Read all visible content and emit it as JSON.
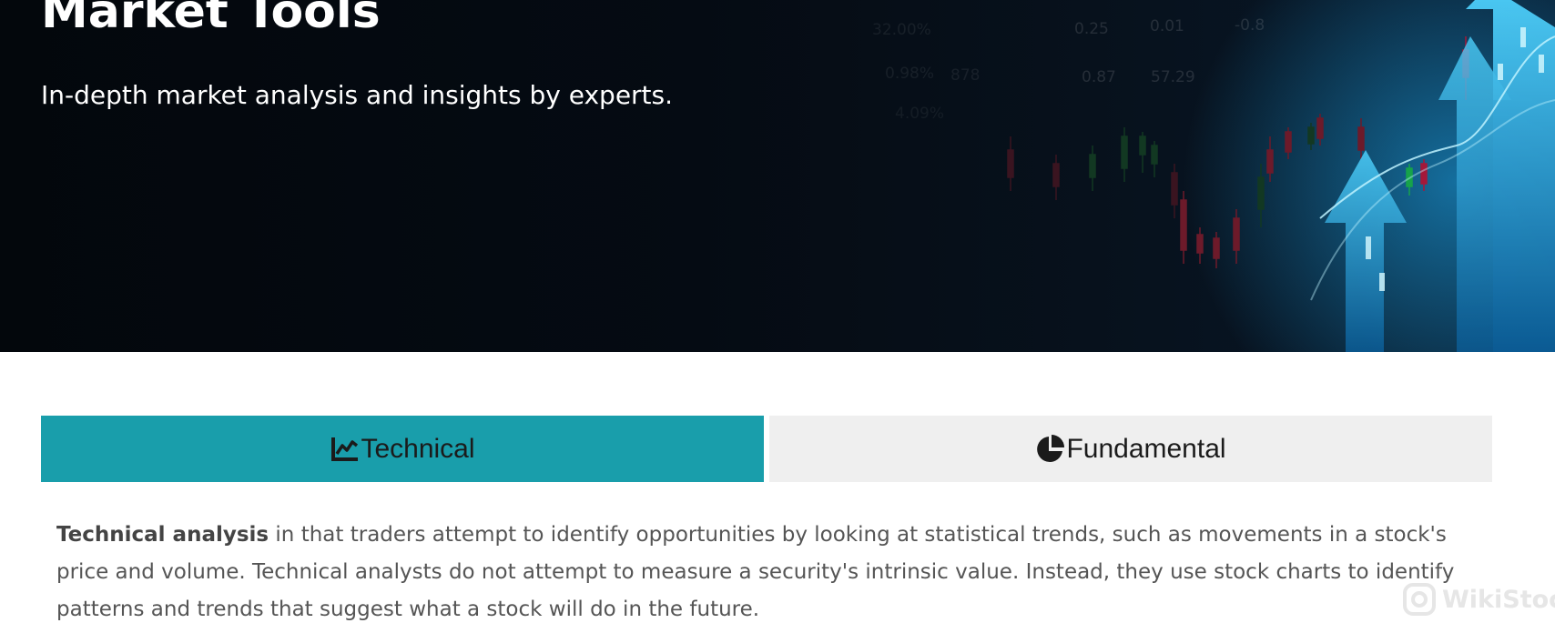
{
  "hero": {
    "title": "Market Tools",
    "subtitle": "In-depth market analysis and insights by experts.",
    "ticker_numbers": [
      "0.25",
      "0.01",
      "-0.8",
      "0.87",
      "57.29",
      "32.00%",
      "0.98%",
      "878",
      "4.09%"
    ]
  },
  "tabs": [
    {
      "label": "Technical",
      "icon": "line-chart-icon",
      "active": true,
      "color": "#199eab"
    },
    {
      "label": "Fundamental",
      "icon": "pie-chart-icon",
      "active": false,
      "color": "#efefef"
    }
  ],
  "content": {
    "bold_term": "Technical analysis",
    "body": " in that traders attempt to identify opportunities by looking at statistical trends, such as movements in a stock's price and volume. Technical analysts do not attempt to measure a security's intrinsic value. Instead, they use stock charts to identify patterns and trends that suggest what a stock will do in the future."
  },
  "watermark": {
    "text": "WikiStock"
  }
}
